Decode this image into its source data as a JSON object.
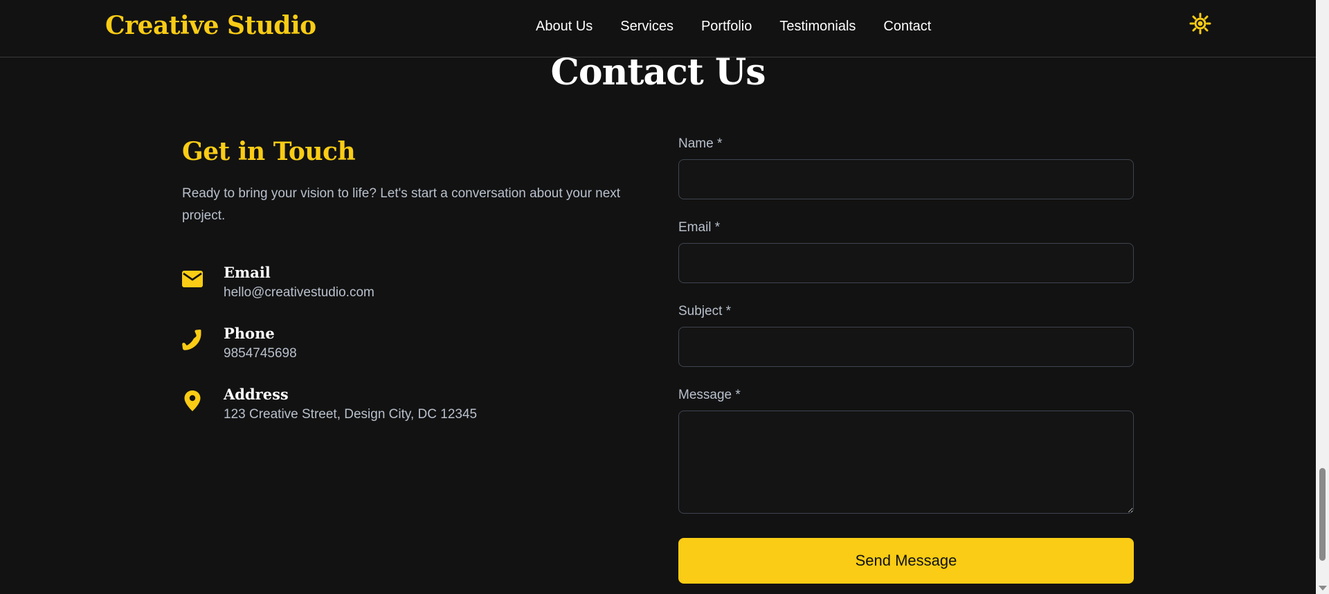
{
  "header": {
    "logo": "Creative Studio",
    "nav": [
      "About Us",
      "Services",
      "Portfolio",
      "Testimonials",
      "Contact"
    ],
    "theme_toggle_icon": "sun-icon"
  },
  "contact": {
    "title": "Contact Us",
    "touch_heading": "Get in Touch",
    "touch_text": "Ready to bring your vision to life? Let's start a conversation about your next project.",
    "info": [
      {
        "icon": "envelope-icon",
        "title": "Email",
        "value": "hello@creativestudio.com"
      },
      {
        "icon": "phone-icon",
        "title": "Phone",
        "value": "9854745698"
      },
      {
        "icon": "map-pin-icon",
        "title": "Address",
        "value": "123 Creative Street, Design City, DC 12345"
      }
    ]
  },
  "form": {
    "name_label": "Name *",
    "email_label": "Email *",
    "subject_label": "Subject *",
    "message_label": "Message *",
    "name_value": "",
    "email_value": "",
    "subject_value": "",
    "message_value": "",
    "submit_label": "Send Message"
  },
  "colors": {
    "background": "#121212",
    "accent": "#facc15",
    "muted_text": "#b8c0cc",
    "field_border": "#3f4450"
  }
}
